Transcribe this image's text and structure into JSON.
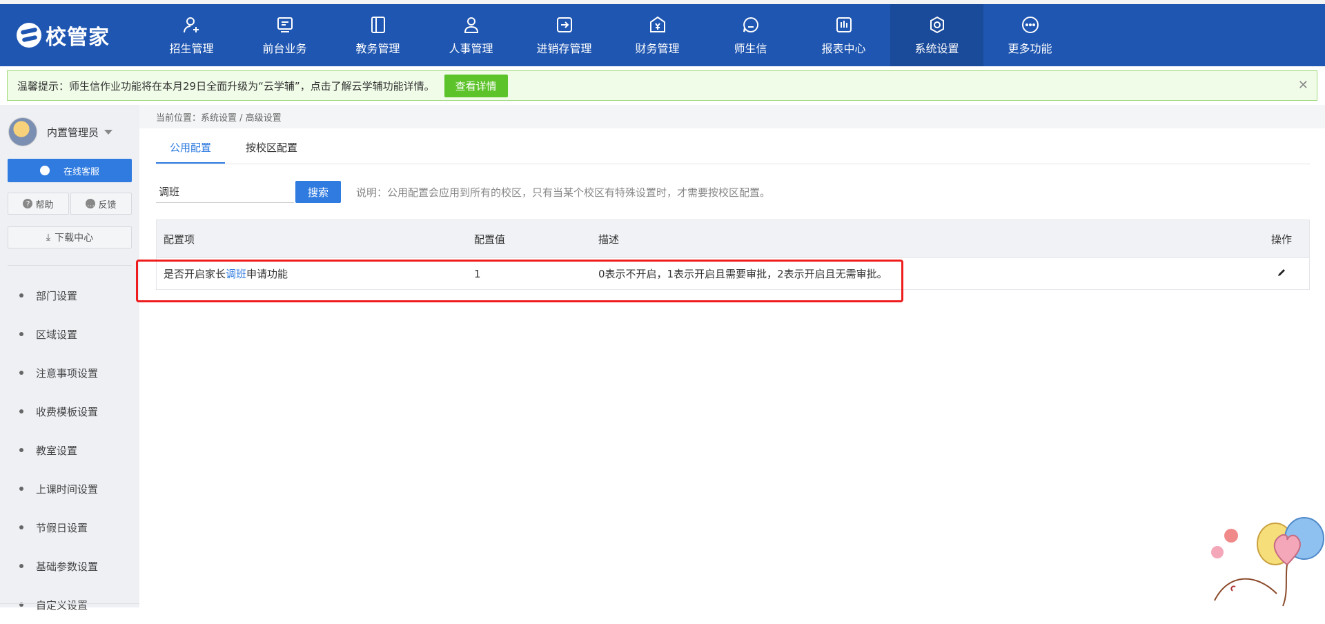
{
  "brand": {
    "name": "校管家"
  },
  "nav": [
    {
      "label": "招生管理",
      "icon": "user-plus-icon"
    },
    {
      "label": "前台业务",
      "icon": "desk-icon"
    },
    {
      "label": "教务管理",
      "icon": "book-icon"
    },
    {
      "label": "人事管理",
      "icon": "person-icon"
    },
    {
      "label": "进销存管理",
      "icon": "inventory-icon"
    },
    {
      "label": "财务管理",
      "icon": "finance-icon"
    },
    {
      "label": "师生信",
      "icon": "chat-icon"
    },
    {
      "label": "报表中心",
      "icon": "report-icon"
    },
    {
      "label": "系统设置",
      "icon": "settings-icon",
      "active": true
    },
    {
      "label": "更多功能",
      "icon": "more-icon"
    }
  ],
  "notice": {
    "text": "温馨提示：师生信作业功能将在本月29日全面升级为“云学辅”，点击了解云学辅功能详情。",
    "button": "查看详情",
    "close": "✕"
  },
  "sidebar": {
    "user_name": "内置管理员",
    "service_label": "在线客服",
    "help_label": "帮助",
    "feedback_label": "反馈",
    "download_label": "下载中心",
    "menu": [
      "部门设置",
      "区域设置",
      "注意事项设置",
      "收费模板设置",
      "教室设置",
      "上课时间设置",
      "节假日设置",
      "基础参数设置",
      "自定义设置"
    ]
  },
  "breadcrumb": "当前位置：系统设置 / 高级设置",
  "tabs": [
    {
      "label": "公用配置",
      "active": true
    },
    {
      "label": "按校区配置",
      "active": false
    }
  ],
  "search": {
    "value": "调班",
    "button": "搜索",
    "tip": "说明：公用配置会应用到所有的校区，只有当某个校区有特殊设置时，才需要按校区配置。"
  },
  "table": {
    "headers": [
      "配置项",
      "配置值",
      "描述",
      "操作"
    ],
    "rows": [
      {
        "item_prefix": "是否开启家长",
        "item_highlight": "调班",
        "item_suffix": "申请功能",
        "value": "1",
        "desc": "0表示不开启，1表示开启且需要审批，2表示开启且无需审批。"
      }
    ]
  },
  "colors": {
    "nav_bg": "#1f56b1",
    "accent": "#2f7be0",
    "notice_btn": "#5cc32a",
    "highlight_box": "#ee1c1c"
  }
}
